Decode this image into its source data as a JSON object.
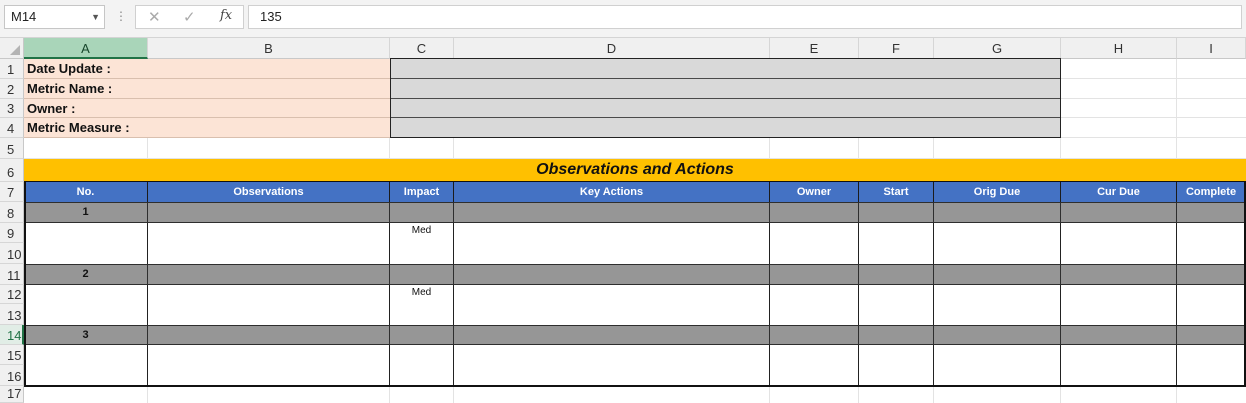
{
  "formula_bar": {
    "name_box": "M14",
    "formula": "135",
    "cancel_icon": "close-icon",
    "enter_icon": "check-icon",
    "fx_label": "fx"
  },
  "columns": [
    "A",
    "B",
    "C",
    "D",
    "E",
    "F",
    "G",
    "H",
    "I"
  ],
  "rows": [
    "1",
    "2",
    "3",
    "4",
    "5",
    "6",
    "7",
    "8",
    "9",
    "10",
    "11",
    "12",
    "13",
    "14",
    "15",
    "16",
    "17"
  ],
  "selection": {
    "cell": "M14",
    "row": "14",
    "column": "A"
  },
  "header_info": {
    "date_update_label": "Date Update :",
    "metric_name_label": "Metric Name :",
    "owner_label": "Owner :",
    "metric_measure_label": "Metric Measure :"
  },
  "section_title": "Observations and Actions",
  "table": {
    "headers": [
      "No.",
      "Observations",
      "Impact",
      "Key Actions",
      "Owner",
      "Start",
      "Orig Due",
      "Cur Due",
      "Complete"
    ],
    "groups": [
      {
        "no": "1",
        "impact": "Med"
      },
      {
        "no": "2",
        "impact": "Med"
      },
      {
        "no": "3",
        "impact": ""
      }
    ]
  },
  "colors": {
    "title_fill": "#ffc000",
    "header_fill": "#4472c4",
    "band_fill": "#969696",
    "label_fill": "#fce4d6",
    "value_fill": "#d9d9d9",
    "selected_header": "#217346"
  }
}
